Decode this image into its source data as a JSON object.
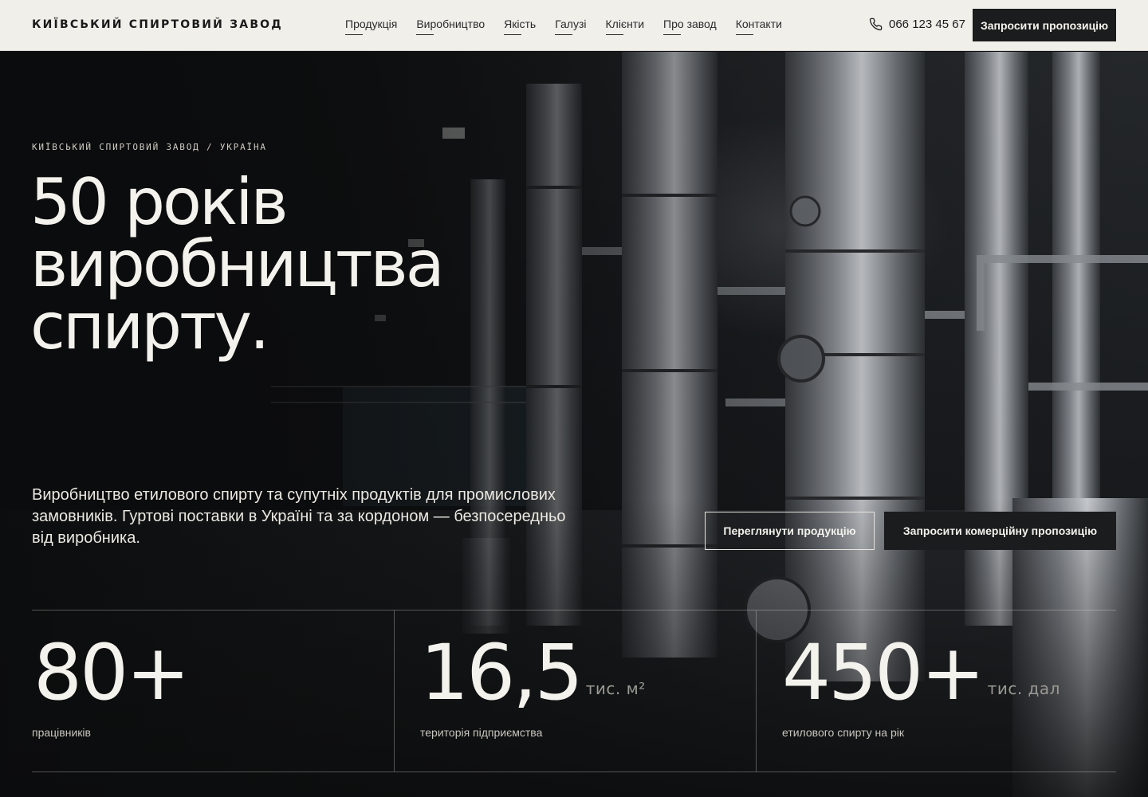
{
  "header": {
    "logo": "КИЇВСЬКИЙ СПИРТОВИЙ ЗАВОД",
    "nav": [
      "Продукція",
      "Виробництво",
      "Якість",
      "Галузі",
      "Клієнти",
      "Про завод",
      "Контакти"
    ],
    "phone": "066 123 45 67",
    "cta": "Запросити пропозицію"
  },
  "hero": {
    "eyebrow": "КИЇВСЬКИЙ СПИРТОВИЙ ЗАВОД / УКРАЇНА",
    "title_lines": [
      "50 років",
      "виробництва",
      "спирту."
    ],
    "lead": "Виробництво етилового спирту та супутніх продуктів для промислових замовників. Гуртові поставки в Україні та за кордоном — безпосередньо від виробника.",
    "btn_secondary": "Переглянути продукцію",
    "btn_primary": "Запросити комерційну пропозицію"
  },
  "stats": [
    {
      "value": "80+",
      "unit": "",
      "label": "працівників"
    },
    {
      "value": "16,5",
      "unit": "тис. м²",
      "label": "територія підприємства"
    },
    {
      "value": "450+",
      "unit": "тис. дал",
      "label": "етилового спирту на рік"
    }
  ],
  "icons": {
    "phone": "phone-icon"
  },
  "colors": {
    "header_bg": "#f1efea",
    "dark": "#1b1c1d",
    "text_light": "#f4f2ec"
  }
}
